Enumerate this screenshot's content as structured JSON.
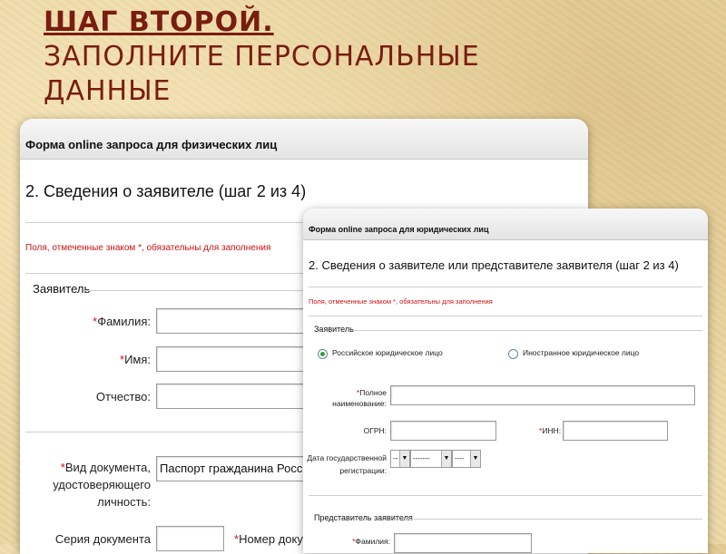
{
  "slide": {
    "title_line1": "ШАГ ВТОРОЙ.",
    "title_line2": "ЗАПОЛНИТЕ ПЕРСОНАЛЬНЫЕ",
    "title_line3": "ДАННЫЕ"
  },
  "form_individual": {
    "window_title": "Форма online запроса для физических лиц",
    "heading": "2. Сведения о заявителе (шаг 2 из 4)",
    "required_note": "Поля, отмеченные знаком *, обязательны для заполнения",
    "section_label": "Заявитель",
    "fields": {
      "surname_label": "Фамилия:",
      "name_label": "Имя:",
      "patronymic_label": "Отчество:",
      "doc_type_label_1": "Вид документа,",
      "doc_type_label_2": "удостоверяющего",
      "doc_type_label_3": "личность:",
      "doc_type_value": "Паспорт гражданина Российской",
      "series_label": "Серия документа",
      "number_label": "Номер докуме"
    },
    "star": "*"
  },
  "form_legal": {
    "window_title": "Форма online запроса для юридических лиц",
    "heading": "2. Сведения о заявителе или представителе заявителя (шаг 2 из 4)",
    "required_note": "Поля, отмеченные знаком *, обязательны для заполнения",
    "section_label": "Заявитель",
    "radio_russian": "Российское юридическое лицо",
    "radio_foreign": "Иностранное юридическое лицо",
    "fullname_label_1": "Полное",
    "fullname_label_2": "наименование:",
    "ogrn_label": "ОГРН:",
    "inn_label": "ИНН:",
    "regdate_label_1": "Дата государственной",
    "regdate_label_2": "регистрации:",
    "day_value": "--",
    "month_value": "-------",
    "year_value": "----",
    "rep_section_label": "Представитель заявителя",
    "rep_surname_label": "Фамилия:",
    "star": "*"
  }
}
